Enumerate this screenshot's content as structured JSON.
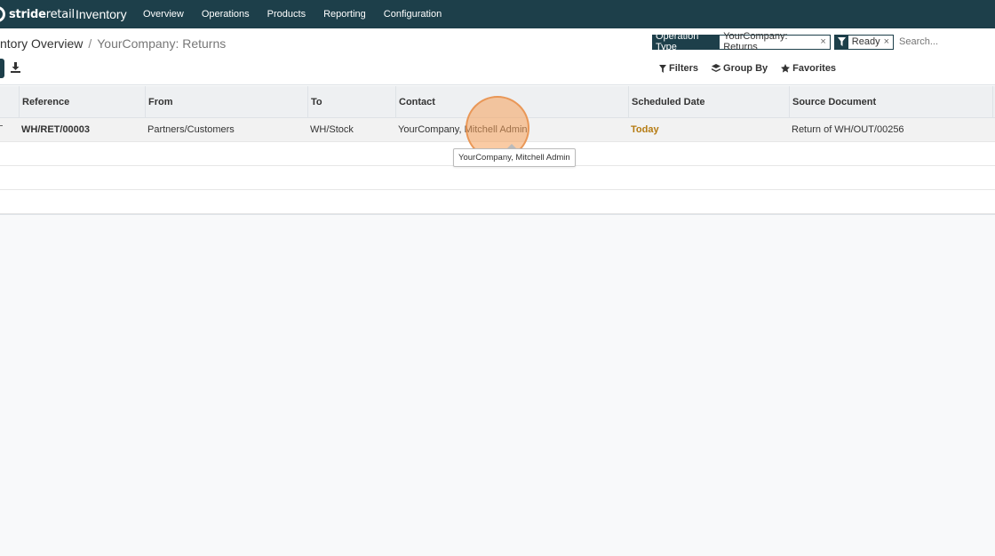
{
  "navbar": {
    "brand": "strideretail",
    "app_name": "Inventory",
    "menu": [
      "Overview",
      "Operations",
      "Products",
      "Reporting",
      "Configuration"
    ]
  },
  "breadcrumb": {
    "parent": "ntory Overview",
    "separator": "/",
    "current": "YourCompany: Returns"
  },
  "search": {
    "facets": [
      {
        "label": "Operation Type",
        "value": "YourCompany: Returns",
        "icon": ""
      },
      {
        "label": "",
        "value": "Ready",
        "icon": "filter-icon"
      }
    ],
    "placeholder": "Search..."
  },
  "actions": {
    "filters": "Filters",
    "group_by": "Group By",
    "favorites": "Favorites"
  },
  "table": {
    "columns": [
      "Reference",
      "From",
      "To",
      "Contact",
      "Scheduled Date",
      "Source Document"
    ],
    "rows": [
      {
        "reference": "WH/RET/00003",
        "from": "Partners/Customers",
        "to": "WH/Stock",
        "contact": "YourCompany, Mitchell Admin",
        "scheduled_date": "Today",
        "source_document": "Return of WH/OUT/00256"
      }
    ]
  },
  "tooltip": "YourCompany, Mitchell Admin",
  "colors": {
    "navbar": "#1d3f4a",
    "today": "#b57b12",
    "click_highlight": "#f5a05a"
  }
}
